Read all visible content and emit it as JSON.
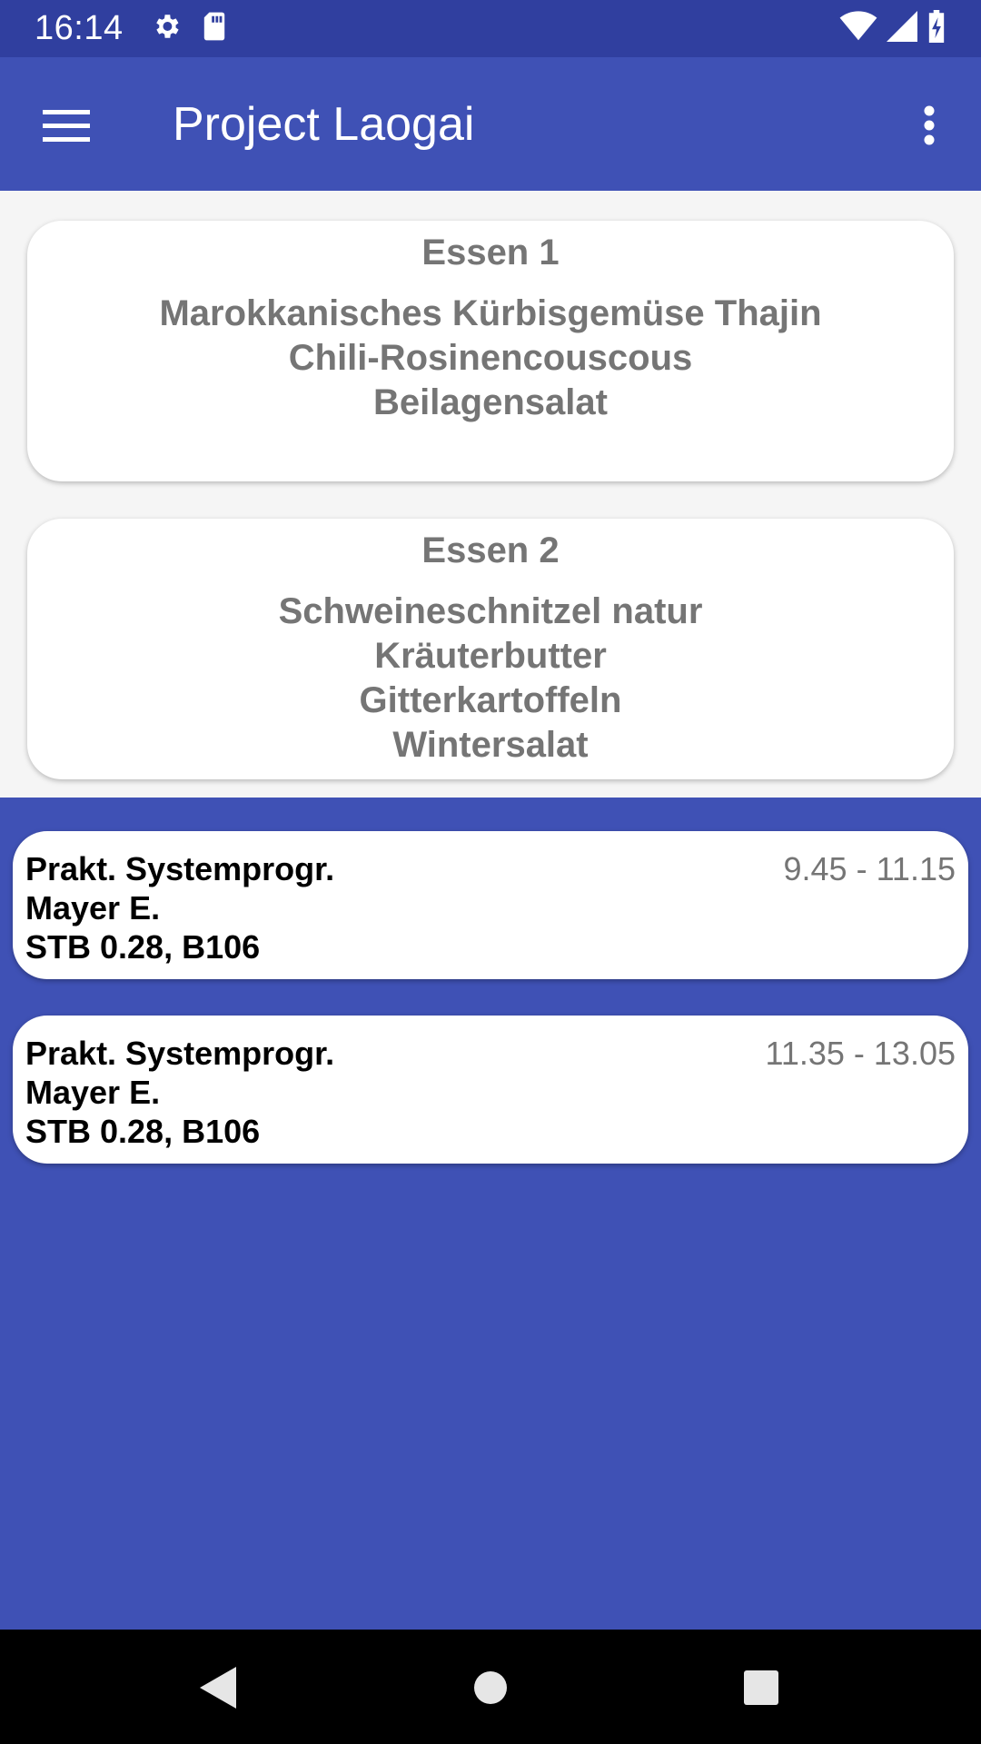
{
  "status_bar": {
    "time": "16:14",
    "icons": [
      "gear-icon",
      "sd-card-icon",
      "wifi-icon",
      "signal-icon",
      "battery-charging-icon"
    ]
  },
  "app_bar": {
    "title": "Project Laogai",
    "menu_icon": "hamburger-menu-icon",
    "overflow_icon": "more-vert-icon"
  },
  "meals": [
    {
      "title": "Essen 1",
      "lines": [
        "Marokkanisches Kürbisgemüse Thajin",
        "Chili-Rosinencouscous",
        "Beilagensalat"
      ]
    },
    {
      "title": "Essen 2",
      "lines": [
        "Schweineschnitzel natur",
        "Kräuterbutter",
        "Gitterkartoffeln",
        "Wintersalat"
      ]
    }
  ],
  "lessons": [
    {
      "course": "Prakt. Systemprogr.",
      "teacher": "Mayer E.",
      "room": "STB 0.28, B106",
      "time": "9.45 - 11.15"
    },
    {
      "course": "Prakt. Systemprogr.",
      "teacher": "Mayer E.",
      "room": "STB 0.28, B106",
      "time": "11.35 - 13.05"
    }
  ],
  "colors": {
    "primary": "#3F51B5",
    "primary_dark": "#303F9F",
    "meal_text": "#757575",
    "meals_background": "#F5F5F5"
  },
  "nav_bar": {
    "icons": [
      "back-icon",
      "home-icon",
      "recents-icon"
    ]
  }
}
